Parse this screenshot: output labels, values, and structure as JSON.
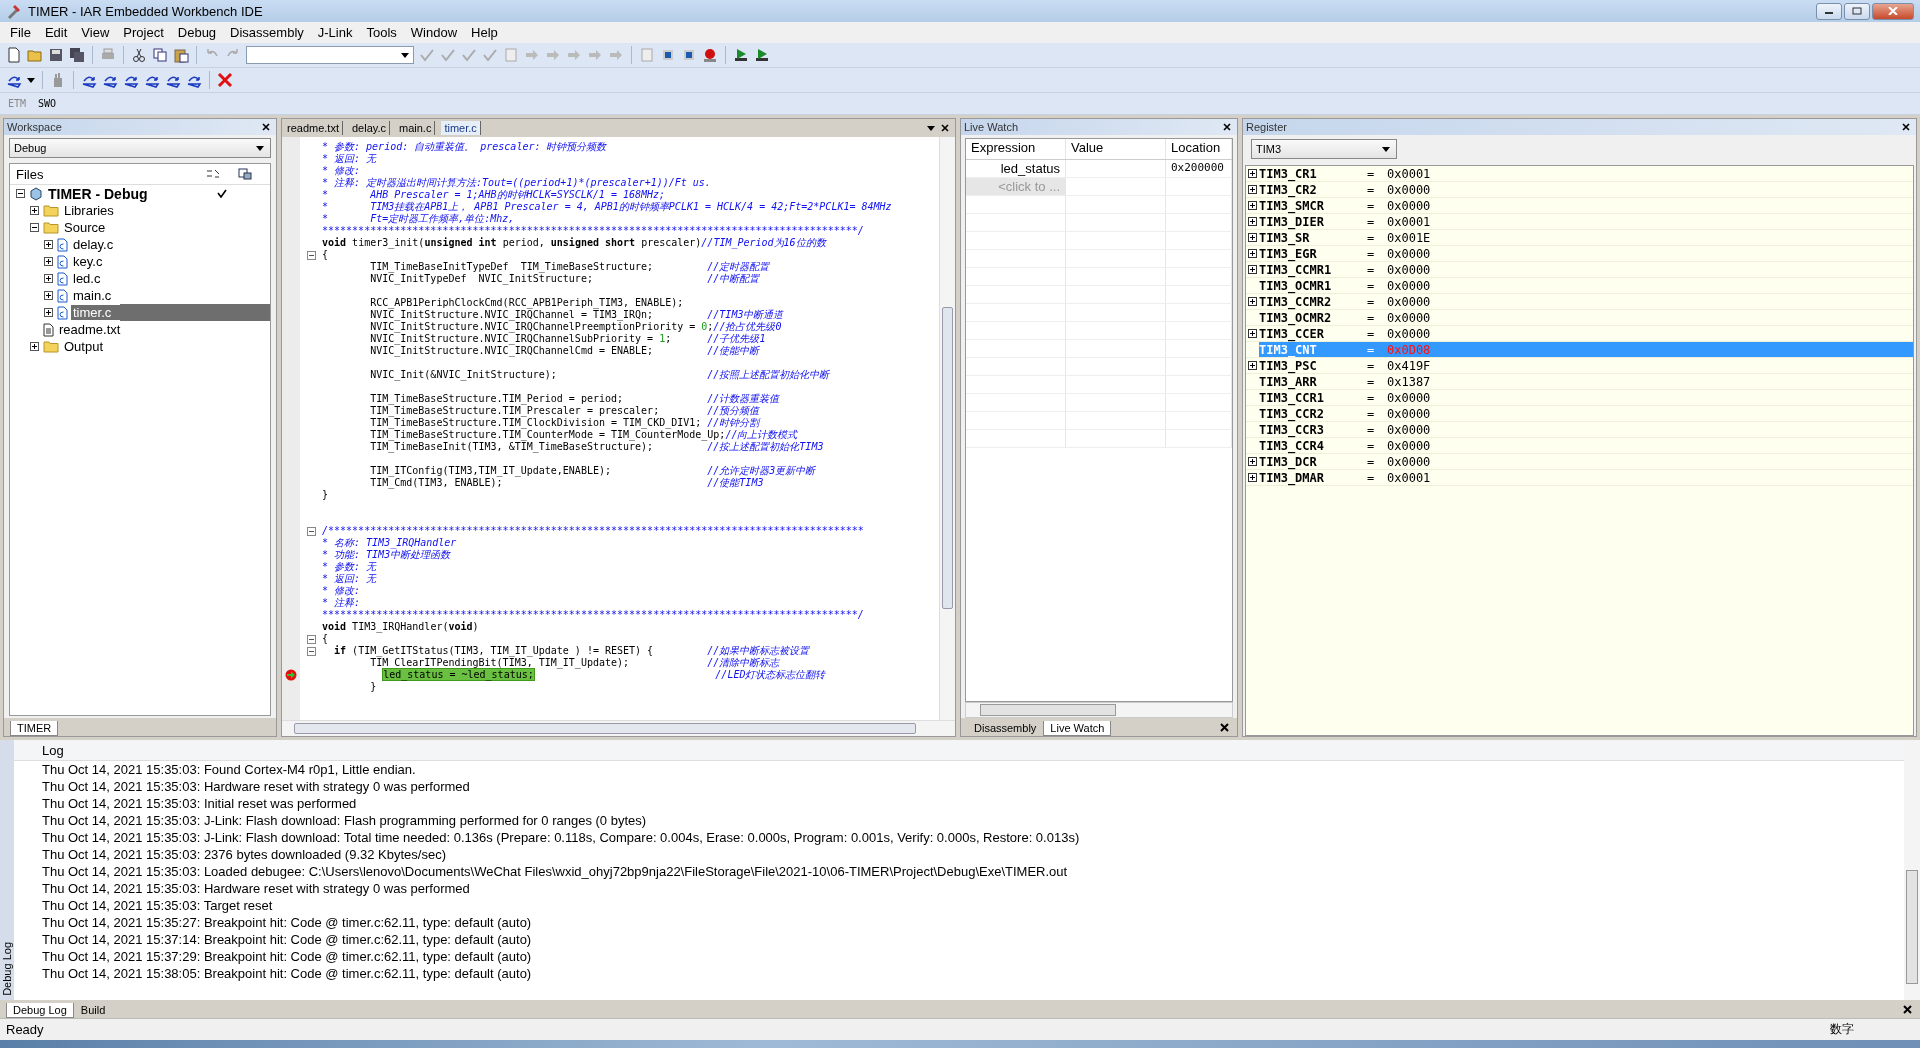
{
  "window": {
    "title": "TIMER - IAR Embedded Workbench IDE"
  },
  "menu": [
    "File",
    "Edit",
    "View",
    "Project",
    "Debug",
    "Disassembly",
    "J-Link",
    "Tools",
    "Window",
    "Help"
  ],
  "toolbar3": [
    "ETM",
    "SWO"
  ],
  "workspace": {
    "title": "Workspace",
    "configuration": "Debug",
    "files_header": "Files",
    "tree": [
      {
        "label": "TIMER - Debug",
        "kind": "project",
        "expanded": true,
        "checked": true,
        "selected": false,
        "children": [
          {
            "label": "Libraries",
            "kind": "folder",
            "expanded": false,
            "checked": false,
            "selected": false
          },
          {
            "label": "Source",
            "kind": "folder",
            "expanded": true,
            "checked": false,
            "selected": false,
            "children": [
              {
                "label": "delay.c",
                "kind": "file",
                "expanded": false,
                "checked": false,
                "selected": false
              },
              {
                "label": "key.c",
                "kind": "file",
                "expanded": false,
                "checked": false,
                "selected": false
              },
              {
                "label": "led.c",
                "kind": "file",
                "expanded": false,
                "checked": false,
                "selected": false
              },
              {
                "label": "main.c",
                "kind": "file",
                "expanded": false,
                "checked": false,
                "selected": false
              },
              {
                "label": "timer.c",
                "kind": "file",
                "expanded": false,
                "checked": false,
                "selected": true
              }
            ]
          },
          {
            "label": "readme.txt",
            "kind": "text",
            "checked": false,
            "selected": false
          },
          {
            "label": "Output",
            "kind": "folder",
            "expanded": false,
            "checked": false,
            "selected": false
          }
        ]
      }
    ],
    "tab": "TIMER"
  },
  "editor": {
    "tabs": [
      {
        "label": "readme.txt",
        "selected": false
      },
      {
        "label": "delay.c",
        "selected": false
      },
      {
        "label": "main.c",
        "selected": false
      },
      {
        "label": "timer.c",
        "selected": true
      }
    ],
    "lines": [
      {
        "fold": false,
        "pc": false,
        "segments": [
          {
            "kind": "comment",
            "text": "* 参数: period: 自动重装值。 prescaler: 时钟预分频数"
          }
        ]
      },
      {
        "fold": false,
        "pc": false,
        "segments": [
          {
            "kind": "comment",
            "text": "* 返回: 无"
          }
        ]
      },
      {
        "fold": false,
        "pc": false,
        "segments": [
          {
            "kind": "comment",
            "text": "* 修改:"
          }
        ]
      },
      {
        "fold": false,
        "pc": false,
        "segments": [
          {
            "kind": "comment",
            "text": "* 注释: 定时器溢出时间计算方法:Tout=((period+1)*(prescaler+1))/Ft us."
          }
        ]
      },
      {
        "fold": false,
        "pc": false,
        "segments": [
          {
            "kind": "comment",
            "text": "*       AHB Prescaler = 1;AHB的时钟HCLK=SYSCLK/1 = 168MHz;"
          }
        ]
      },
      {
        "fold": false,
        "pc": false,
        "segments": [
          {
            "kind": "comment",
            "text": "*       TIM3挂载在APB1上， APB1 Prescaler = 4, APB1的时钟频率PCLK1 = HCLK/4 = 42;Ft=2*PCLK1= 84MHz"
          }
        ]
      },
      {
        "fold": false,
        "pc": false,
        "segments": [
          {
            "kind": "comment",
            "text": "*       Ft=定时器工作频率,单位:Mhz,"
          }
        ]
      },
      {
        "fold": false,
        "pc": false,
        "segments": [
          {
            "kind": "comment",
            "text": "*****************************************************************************************/"
          }
        ]
      },
      {
        "fold": false,
        "pc": false,
        "segments": [
          {
            "kind": "keyword",
            "text": "void"
          },
          {
            "kind": "plain",
            "text": " timer3_init("
          },
          {
            "kind": "keyword",
            "text": "unsigned int"
          },
          {
            "kind": "plain",
            "text": " period, "
          },
          {
            "kind": "keyword",
            "text": "unsigned short"
          },
          {
            "kind": "plain",
            "text": " prescaler)"
          },
          {
            "kind": "comment",
            "text": "//TIM_Period为16位的数"
          }
        ]
      },
      {
        "fold": true,
        "pc": false,
        "segments": [
          {
            "kind": "plain",
            "text": "{"
          }
        ]
      },
      {
        "fold": false,
        "pc": false,
        "segments": [
          {
            "kind": "plain",
            "text": "        TIM_TimeBaseInitTypeDef  TIM_TimeBaseStructure;         "
          },
          {
            "kind": "comment",
            "text": "//定时器配置"
          }
        ]
      },
      {
        "fold": false,
        "pc": false,
        "segments": [
          {
            "kind": "plain",
            "text": "        NVIC_InitTypeDef  NVIC_InitStructure;                   "
          },
          {
            "kind": "comment",
            "text": "//中断配置"
          }
        ]
      },
      {
        "fold": false,
        "pc": false
      },
      {
        "fold": false,
        "pc": false,
        "segments": [
          {
            "kind": "plain",
            "text": "        RCC_APB1PeriphClockCmd(RCC_APB1Periph_TIM3, ENABLE);"
          }
        ]
      },
      {
        "fold": false,
        "pc": false,
        "segments": [
          {
            "kind": "plain",
            "text": "        NVIC_InitStructure.NVIC_IRQChannel = TIM3_IRQn;         "
          },
          {
            "kind": "comment",
            "text": "//TIM3中断通道"
          }
        ]
      },
      {
        "fold": false,
        "pc": false,
        "segments": [
          {
            "kind": "plain",
            "text": "        NVIC_InitStructure.NVIC_IRQChannelPreemptionPriority = "
          },
          {
            "kind": "number",
            "text": "0"
          },
          {
            "kind": "plain",
            "text": ";"
          },
          {
            "kind": "comment",
            "text": "//抢占优先级0"
          }
        ]
      },
      {
        "fold": false,
        "pc": false,
        "segments": [
          {
            "kind": "plain",
            "text": "        NVIC_InitStructure.NVIC_IRQChannelSubPriority = "
          },
          {
            "kind": "number",
            "text": "1"
          },
          {
            "kind": "plain",
            "text": ";      "
          },
          {
            "kind": "comment",
            "text": "//子优先级1"
          }
        ]
      },
      {
        "fold": false,
        "pc": false,
        "segments": [
          {
            "kind": "plain",
            "text": "        NVIC_InitStructure.NVIC_IRQChannelCmd = ENABLE;         "
          },
          {
            "kind": "comment",
            "text": "//使能中断"
          }
        ]
      },
      {
        "fold": false,
        "pc": false
      },
      {
        "fold": false,
        "pc": false,
        "segments": [
          {
            "kind": "plain",
            "text": "        NVIC_Init(&NVIC_InitStructure);                         "
          },
          {
            "kind": "comment",
            "text": "//按照上述配置初始化中断"
          }
        ]
      },
      {
        "fold": false,
        "pc": false
      },
      {
        "fold": false,
        "pc": false,
        "segments": [
          {
            "kind": "plain",
            "text": "        TIM_TimeBaseStructure.TIM_Period = period;              "
          },
          {
            "kind": "comment",
            "text": "//计数器重装值"
          }
        ]
      },
      {
        "fold": false,
        "pc": false,
        "segments": [
          {
            "kind": "plain",
            "text": "        TIM_TimeBaseStructure.TIM_Prescaler = prescaler;        "
          },
          {
            "kind": "comment",
            "text": "//预分频值"
          }
        ]
      },
      {
        "fold": false,
        "pc": false,
        "segments": [
          {
            "kind": "plain",
            "text": "        TIM_TimeBaseStructure.TIM_ClockDivision = TIM_CKD_DIV1; "
          },
          {
            "kind": "comment",
            "text": "//时钟分割"
          }
        ]
      },
      {
        "fold": false,
        "pc": false,
        "segments": [
          {
            "kind": "plain",
            "text": "        TIM_TimeBaseStructure.TIM_CounterMode = TIM_CounterMode_Up;"
          },
          {
            "kind": "comment",
            "text": "//向上计数模式"
          }
        ]
      },
      {
        "fold": false,
        "pc": false,
        "segments": [
          {
            "kind": "plain",
            "text": "        TIM_TimeBaseInit(TIM3, &TIM_TimeBaseStructure);         "
          },
          {
            "kind": "comment",
            "text": "//按上述配置初始化TIM3"
          }
        ]
      },
      {
        "fold": false,
        "pc": false
      },
      {
        "fold": false,
        "pc": false,
        "segments": [
          {
            "kind": "plain",
            "text": "        TIM_ITConfig(TIM3,TIM_IT_Update,ENABLE);                "
          },
          {
            "kind": "comment",
            "text": "//允许定时器3更新中断"
          }
        ]
      },
      {
        "fold": false,
        "pc": false,
        "segments": [
          {
            "kind": "plain",
            "text": "        TIM_Cmd(TIM3, ENABLE);                                  "
          },
          {
            "kind": "comment",
            "text": "//使能TIM3"
          }
        ]
      },
      {
        "fold": false,
        "pc": false,
        "segments": [
          {
            "kind": "plain",
            "text": "}"
          }
        ]
      },
      {
        "fold": false,
        "pc": false
      },
      {
        "fold": false,
        "pc": false
      },
      {
        "fold": true,
        "pc": false,
        "segments": [
          {
            "kind": "comment",
            "text": "/*****************************************************************************************"
          }
        ]
      },
      {
        "fold": false,
        "pc": false,
        "segments": [
          {
            "kind": "comment",
            "text": "* 名称: TIM3_IRQHandler"
          }
        ]
      },
      {
        "fold": false,
        "pc": false,
        "segments": [
          {
            "kind": "comment",
            "text": "* 功能: TIM3中断处理函数"
          }
        ]
      },
      {
        "fold": false,
        "pc": false,
        "segments": [
          {
            "kind": "comment",
            "text": "* 参数: 无"
          }
        ]
      },
      {
        "fold": false,
        "pc": false,
        "segments": [
          {
            "kind": "comment",
            "text": "* 返回: 无"
          }
        ]
      },
      {
        "fold": false,
        "pc": false,
        "segments": [
          {
            "kind": "comment",
            "text": "* 修改:"
          }
        ]
      },
      {
        "fold": false,
        "pc": false,
        "segments": [
          {
            "kind": "comment",
            "text": "* 注释:"
          }
        ]
      },
      {
        "fold": false,
        "pc": false,
        "segments": [
          {
            "kind": "comment",
            "text": "*****************************************************************************************/"
          }
        ]
      },
      {
        "fold": false,
        "pc": false,
        "segments": [
          {
            "kind": "keyword",
            "text": "void"
          },
          {
            "kind": "plain",
            "text": " TIM3_IRQHandler("
          },
          {
            "kind": "keyword",
            "text": "void"
          },
          {
            "kind": "plain",
            "text": ")"
          }
        ]
      },
      {
        "fold": true,
        "pc": false,
        "segments": [
          {
            "kind": "plain",
            "text": "{"
          }
        ]
      },
      {
        "fold": true,
        "pc": false,
        "segments": [
          {
            "kind": "keyword",
            "text": "  if"
          },
          {
            "kind": "plain",
            "text": " (TIM_GetITStatus(TIM3, TIM_IT_Update ) != RESET) {         "
          },
          {
            "kind": "comment",
            "text": "//如果中断标志被设置"
          }
        ]
      },
      {
        "fold": false,
        "pc": false,
        "segments": [
          {
            "kind": "plain",
            "text": "        TIM_ClearITPendingBit(TIM3, TIM_IT_Update);             "
          },
          {
            "kind": "comment",
            "text": "//清除中断标志"
          }
        ]
      },
      {
        "fold": false,
        "pc": true,
        "segments": [
          {
            "kind": "current",
            "text": "          led_status = ~led_status;"
          },
          {
            "kind": "comment",
            "text": "                              //LED灯状态标志位翻转"
          }
        ]
      },
      {
        "fold": false,
        "pc": false,
        "segments": [
          {
            "kind": "plain",
            "text": "        }"
          }
        ]
      }
    ]
  },
  "live_watch": {
    "title": "Live Watch",
    "columns": [
      "Expression",
      "Value",
      "Location"
    ],
    "rows": [
      {
        "expression": "led_status",
        "location": "0x200000",
        "placeholder": false
      },
      {
        "expression": "<click to ...",
        "placeholder": true
      }
    ],
    "tabs": [
      {
        "label": "Disassembly",
        "selected": false
      },
      {
        "label": "Live Watch",
        "selected": true
      }
    ]
  },
  "register": {
    "title": "Register",
    "group": "TIM3",
    "rows": [
      {
        "name": "TIM3_CR1",
        "op": "=",
        "value": "0x0001",
        "expandable": true,
        "selected": false,
        "changed": false
      },
      {
        "name": "TIM3_CR2",
        "op": "=",
        "value": "0x0000",
        "expandable": true,
        "selected": false,
        "changed": false
      },
      {
        "name": "TIM3_SMCR",
        "op": "=",
        "value": "0x0000",
        "expandable": true,
        "selected": false,
        "changed": false
      },
      {
        "name": "TIM3_DIER",
        "op": "=",
        "value": "0x0001",
        "expandable": true,
        "selected": false,
        "changed": false
      },
      {
        "name": "TIM3_SR",
        "op": "=",
        "value": "0x001E",
        "expandable": true,
        "selected": false,
        "changed": false
      },
      {
        "name": "TIM3_EGR",
        "op": "=",
        "value": "0x0000",
        "expandable": true,
        "selected": false,
        "changed": false
      },
      {
        "name": "TIM3_CCMR1",
        "op": "=",
        "value": "0x0000",
        "expandable": true,
        "selected": false,
        "changed": false
      },
      {
        "name": "TIM3_OCMR1",
        "op": "=",
        "value": "0x0000",
        "expandable": false,
        "selected": false,
        "changed": false
      },
      {
        "name": "TIM3_CCMR2",
        "op": "=",
        "value": "0x0000",
        "expandable": true,
        "selected": false,
        "changed": false
      },
      {
        "name": "TIM3_OCMR2",
        "op": "=",
        "value": "0x0000",
        "expandable": false,
        "selected": false,
        "changed": false
      },
      {
        "name": "TIM3_CCER",
        "op": "=",
        "value": "0x0000",
        "expandable": true,
        "selected": false,
        "changed": false
      },
      {
        "name": "TIM3_CNT",
        "op": "=",
        "value": "0x0D08",
        "expandable": false,
        "selected": true,
        "changed": true
      },
      {
        "name": "TIM3_PSC",
        "op": "=",
        "value": "0x419F",
        "expandable": true,
        "selected": false,
        "changed": false
      },
      {
        "name": "TIM3_ARR",
        "op": "=",
        "value": "0x1387",
        "expandable": false,
        "selected": false,
        "changed": false
      },
      {
        "name": "TIM3_CCR1",
        "op": "=",
        "value": "0x0000",
        "expandable": false,
        "selected": false,
        "changed": false
      },
      {
        "name": "TIM3_CCR2",
        "op": "=",
        "value": "0x0000",
        "expandable": false,
        "selected": false,
        "changed": false
      },
      {
        "name": "TIM3_CCR3",
        "op": "=",
        "value": "0x0000",
        "expandable": false,
        "selected": false,
        "changed": false
      },
      {
        "name": "TIM3_CCR4",
        "op": "=",
        "value": "0x0000",
        "expandable": false,
        "selected": false,
        "changed": false
      },
      {
        "name": "TIM3_DCR",
        "op": "=",
        "value": "0x0000",
        "expandable": true,
        "selected": false,
        "changed": false
      },
      {
        "name": "TIM3_DMAR",
        "op": "=",
        "value": "0x0001",
        "expandable": true,
        "selected": false,
        "changed": false
      }
    ]
  },
  "log": {
    "side_label": "Debug Log",
    "header": "Log",
    "lines": [
      "Thu Oct 14, 2021 15:35:03: Found Cortex-M4 r0p1, Little endian.",
      "Thu Oct 14, 2021 15:35:03: Hardware reset with strategy 0 was performed",
      "Thu Oct 14, 2021 15:35:03: Initial reset was performed",
      "Thu Oct 14, 2021 15:35:03: J-Link: Flash download: Flash programming performed for 0 ranges (0 bytes)",
      "Thu Oct 14, 2021 15:35:03: J-Link: Flash download: Total time needed: 0.136s (Prepare: 0.118s, Compare: 0.004s, Erase: 0.000s, Program: 0.001s, Verify: 0.000s, Restore: 0.013s)",
      "Thu Oct 14, 2021 15:35:03: 2376 bytes downloaded (9.32 Kbytes/sec)",
      "Thu Oct 14, 2021 15:35:03: Loaded debugee: C:\\Users\\lenovo\\Documents\\WeChat Files\\wxid_ohyj72bp9nja22\\FileStorage\\File\\2021-10\\06-TIMER\\Project\\Debug\\Exe\\TIMER.out",
      "Thu Oct 14, 2021 15:35:03: Hardware reset with strategy 0 was performed",
      "Thu Oct 14, 2021 15:35:03: Target reset",
      "Thu Oct 14, 2021 15:35:27: Breakpoint hit: Code @ timer.c:62.11, type: default (auto)",
      "Thu Oct 14, 2021 15:37:14: Breakpoint hit: Code @ timer.c:62.11, type: default (auto)",
      "Thu Oct 14, 2021 15:37:29: Breakpoint hit: Code @ timer.c:62.11, type: default (auto)",
      "Thu Oct 14, 2021 15:38:05: Breakpoint hit: Code @ timer.c:62.11, type: default (auto)"
    ],
    "tabs": [
      {
        "label": "Debug Log",
        "selected": true
      },
      {
        "label": "Build",
        "selected": false
      }
    ]
  },
  "status_bar": {
    "message": "Ready",
    "indicator": "数字"
  }
}
